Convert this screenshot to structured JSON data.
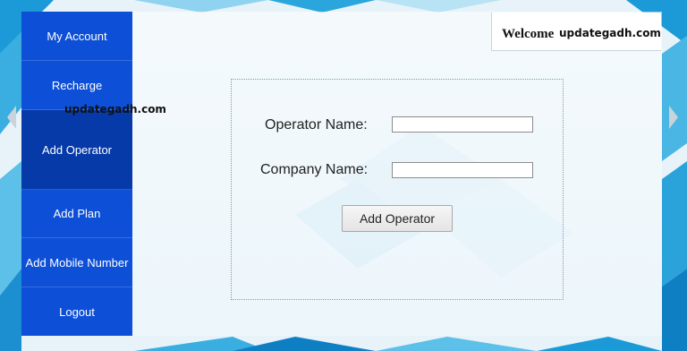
{
  "sidebar": {
    "items": [
      {
        "label": "My Account"
      },
      {
        "label": "Recharge"
      },
      {
        "label": "Add Operator",
        "active": true
      },
      {
        "label": "Add Plan"
      },
      {
        "label": "Add Mobile Number"
      },
      {
        "label": "Logout"
      }
    ]
  },
  "header": {
    "welcome_label": "Welcome",
    "username": "updategadh.com"
  },
  "watermark": "updategadh.com",
  "form": {
    "operator_name_label": "Operator Name:",
    "operator_name_value": "",
    "company_name_label": "Company Name:",
    "company_name_value": "",
    "submit_label": "Add Operator"
  },
  "colors": {
    "sidebar": "#0d4fd6",
    "sidebar_active": "#063aa8",
    "background_accent": "#1a9ad6"
  }
}
